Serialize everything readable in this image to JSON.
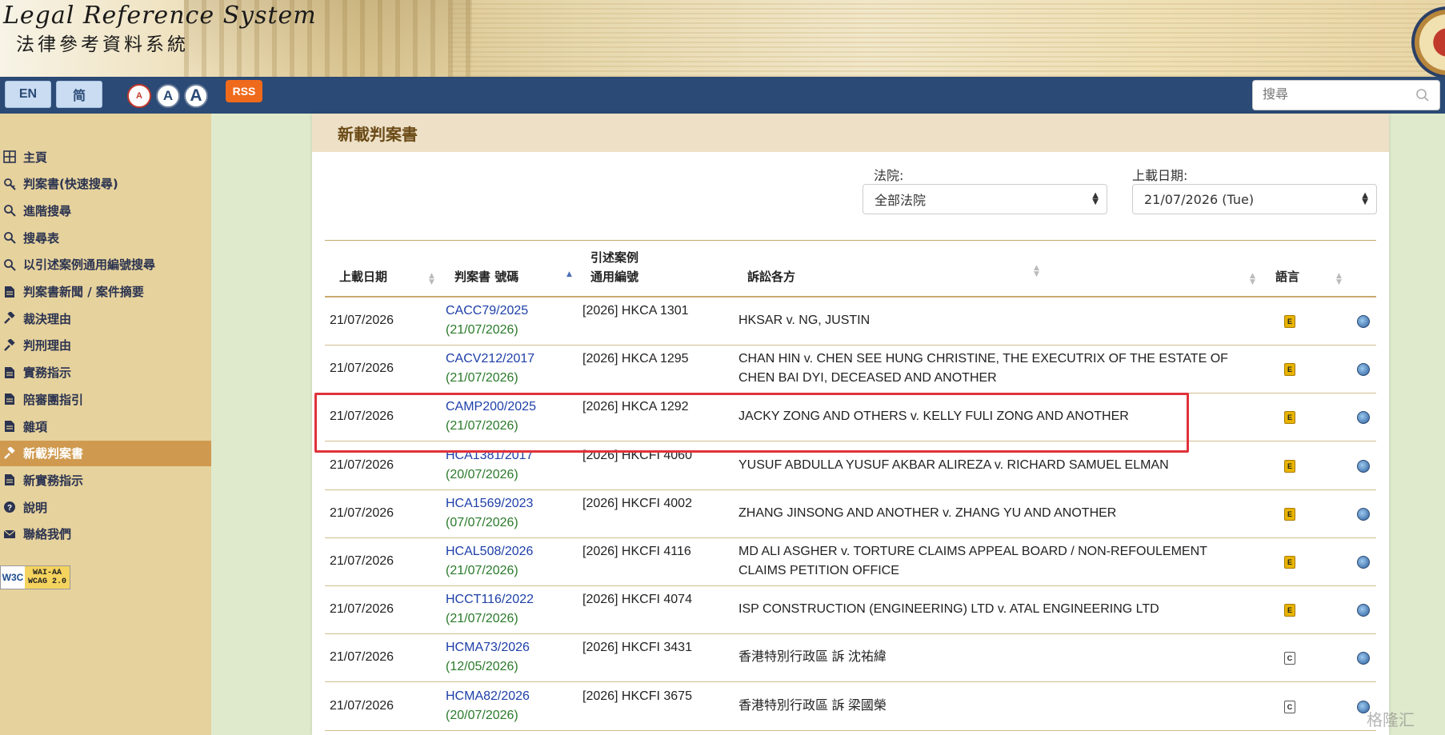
{
  "header": {
    "title_en": "Legal Reference System",
    "title_zh": "法律參考資料系統"
  },
  "navbar": {
    "lang_en": "EN",
    "lang_sc": "简",
    "font_small": "A",
    "font_medium": "A",
    "font_large": "A",
    "rss": "RSS",
    "search_placeholder": "搜尋"
  },
  "sidebar": {
    "items": [
      {
        "label": "主頁",
        "icon": "grid-icon"
      },
      {
        "label": "判案書(快速搜尋)",
        "icon": "quick-search-icon"
      },
      {
        "label": "進階搜尋",
        "icon": "search-icon"
      },
      {
        "label": "搜尋表",
        "icon": "search-icon"
      },
      {
        "label": "以引述案例通用編號搜尋",
        "icon": "search-icon"
      },
      {
        "label": "判案書新聞 / 案件摘要",
        "icon": "document-icon"
      },
      {
        "label": "裁決理由",
        "icon": "gavel-icon"
      },
      {
        "label": "判刑理由",
        "icon": "gavel-icon"
      },
      {
        "label": "實務指示",
        "icon": "document-icon"
      },
      {
        "label": "陪審團指引",
        "icon": "document-icon"
      },
      {
        "label": "雜項",
        "icon": "document-icon"
      },
      {
        "label": "新載判案書",
        "icon": "gavel-icon"
      },
      {
        "label": "新實務指示",
        "icon": "document-icon"
      },
      {
        "label": "說明",
        "icon": "help-icon"
      },
      {
        "label": "聯絡我們",
        "icon": "mail-icon"
      }
    ],
    "active_index": 11,
    "wcag_logo": {
      "w3c": "W3C",
      "line1": "WAI-AA",
      "line2": "WCAG 2.0"
    }
  },
  "main": {
    "title": "新載判案書",
    "filter_court_label": "法院:",
    "filter_court_value": "全部法院",
    "filter_date_label": "上載日期:",
    "filter_date_value": "21/07/2026 (Tue)",
    "columns": {
      "upload_date": "上載日期",
      "judgment_no": "判案書 號碼",
      "citation_line1": "引述案例",
      "citation_line2": "通用編號",
      "parties": "訴訟各方",
      "language": "語言"
    },
    "rows": [
      {
        "upload_date": "21/07/2026",
        "case_no": "CACC79/2025",
        "judgment_date": "(21/07/2026)",
        "citation": "[2026] HKCA 1301",
        "parties": "HKSAR v. NG, JUSTIN",
        "parties_line2": "",
        "lang": "E"
      },
      {
        "upload_date": "21/07/2026",
        "case_no": "CACV212/2017",
        "judgment_date": "(21/07/2026)",
        "citation": "[2026] HKCA 1295",
        "parties": "CHAN HIN v. CHEN SEE HUNG CHRISTINE, THE EXECUTRIX OF THE ESTATE OF",
        "parties_line2": "CHEN BAI DYI, DECEASED AND ANOTHER",
        "lang": "E"
      },
      {
        "upload_date": "21/07/2026",
        "case_no": "CAMP200/2025",
        "judgment_date": "(21/07/2026)",
        "citation": "[2026] HKCA 1292",
        "parties": "JACKY ZONG AND OTHERS v. KELLY FULI ZONG AND ANOTHER",
        "parties_line2": "",
        "lang": "E"
      },
      {
        "upload_date": "21/07/2026",
        "case_no": "HCA1381/2017",
        "judgment_date": "(20/07/2026)",
        "citation": "[2026] HKCFI 4060",
        "parties": "YUSUF ABDULLA YUSUF AKBAR ALIREZA v. RICHARD SAMUEL ELMAN",
        "parties_line2": "",
        "lang": "E"
      },
      {
        "upload_date": "21/07/2026",
        "case_no": "HCA1569/2023",
        "judgment_date": "(07/07/2026)",
        "citation": "[2026] HKCFI 4002",
        "parties": "ZHANG JINSONG AND ANOTHER v. ZHANG YU AND ANOTHER",
        "parties_line2": "",
        "lang": "E"
      },
      {
        "upload_date": "21/07/2026",
        "case_no": "HCAL508/2026",
        "judgment_date": "(21/07/2026)",
        "citation": "[2026] HKCFI 4116",
        "parties": "MD ALI ASGHER v. TORTURE CLAIMS APPEAL BOARD / NON-REFOULEMENT",
        "parties_line2": "CLAIMS PETITION OFFICE",
        "lang": "E"
      },
      {
        "upload_date": "21/07/2026",
        "case_no": "HCCT116/2022",
        "judgment_date": "(21/07/2026)",
        "citation": "[2026] HKCFI 4074",
        "parties": "ISP CONSTRUCTION (ENGINEERING) LTD v. ATAL ENGINEERING LTD",
        "parties_line2": "",
        "lang": "E"
      },
      {
        "upload_date": "21/07/2026",
        "case_no": "HCMA73/2026",
        "judgment_date": "(12/05/2026)",
        "citation": "[2026] HKCFI 3431",
        "parties": "香港特別行政區 訴 沈祐緯",
        "parties_line2": "",
        "lang": "C"
      },
      {
        "upload_date": "21/07/2026",
        "case_no": "HCMA82/2026",
        "judgment_date": "(20/07/2026)",
        "citation": "[2026] HKCFI 3675",
        "parties": "香港特別行政區 訴 梁國榮",
        "parties_line2": "",
        "lang": "C"
      }
    ]
  },
  "watermark": "格隆汇",
  "colors": {
    "navbar": "#2b4a75",
    "sidebar": "#e6d29d",
    "sidebar_active": "#cf9a4f",
    "link": "#1d3fa8",
    "judgment_date": "#2a7a2a",
    "highlight": "#e0323a"
  }
}
